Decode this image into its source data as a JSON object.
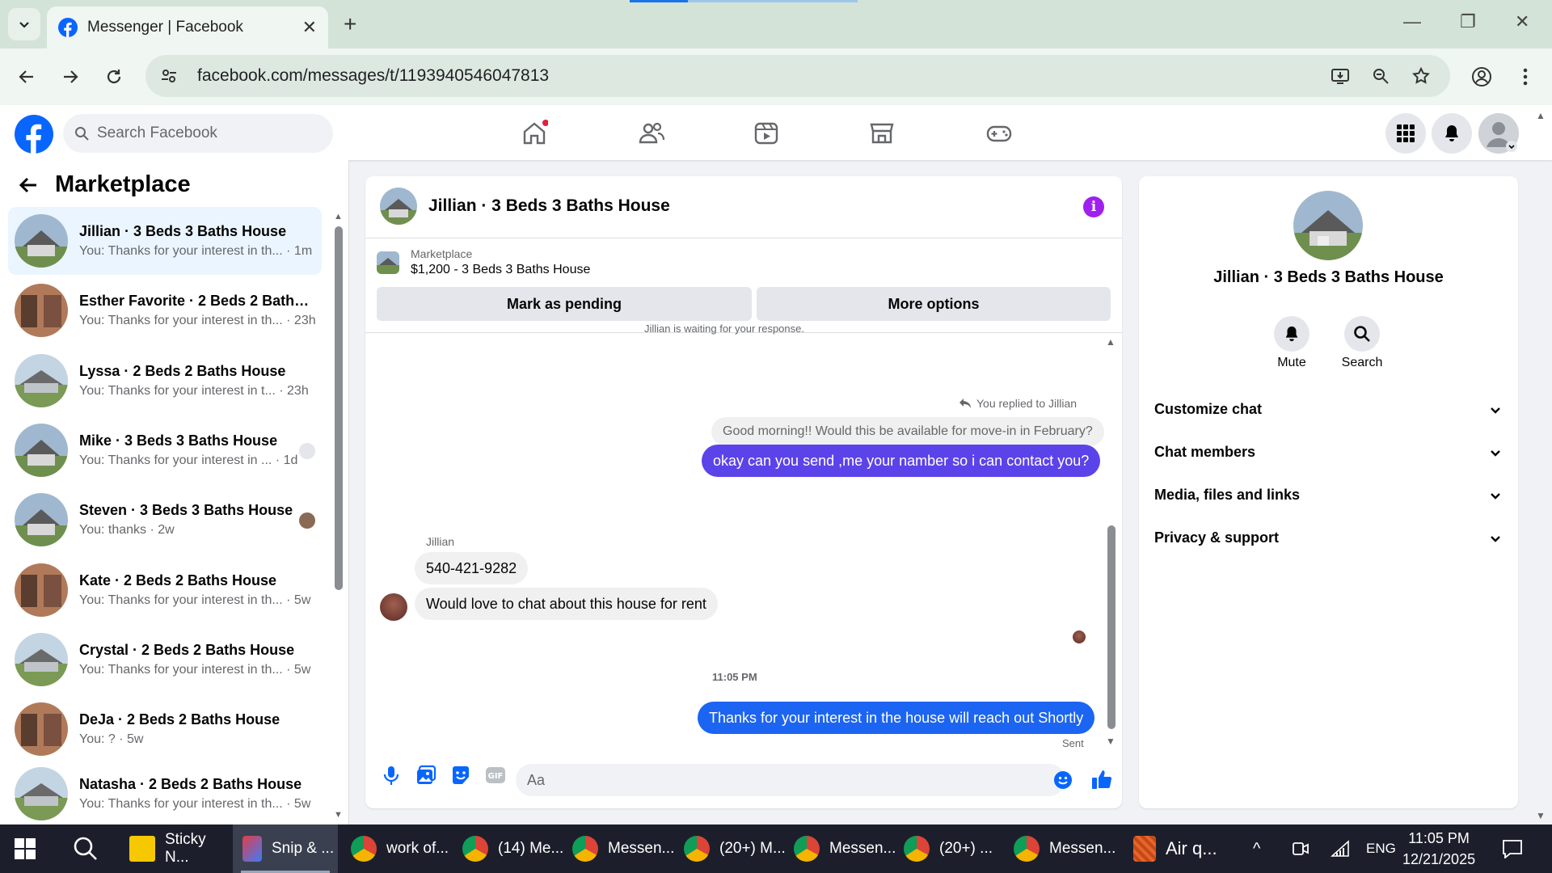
{
  "browser": {
    "tab_title": "Messenger | Facebook",
    "url": "facebook.com/messages/t/1193940546047813"
  },
  "fb": {
    "search_placeholder": "Search Facebook"
  },
  "sidebar": {
    "title": "Marketplace",
    "conversations": [
      {
        "name": "Jillian · 3 Beds 3 Baths House",
        "preview": "You: Thanks for your interest in th... · 1m"
      },
      {
        "name": "Esther Favorite · 2 Beds 2 Baths ...",
        "preview": "You: Thanks for your interest in th... · 23h"
      },
      {
        "name": "Lyssa · 2 Beds 2 Baths House",
        "preview": "You: Thanks for your interest in t... · 23h"
      },
      {
        "name": "Mike · 3 Beds 3 Baths House",
        "preview": "You: Thanks for your interest in ... · 1d"
      },
      {
        "name": "Steven · 3 Beds 3 Baths House",
        "preview": "You: thanks · 2w"
      },
      {
        "name": "Kate · 2 Beds 2 Baths House",
        "preview": "You: Thanks for your interest in th... · 5w"
      },
      {
        "name": "Crystal · 2 Beds 2 Baths House",
        "preview": "You: Thanks for your interest in th... · 5w"
      },
      {
        "name": "DeJa · 2 Beds 2 Baths House",
        "preview": "You: ? · 5w"
      },
      {
        "name": "Natasha · 2 Beds 2 Baths House",
        "preview": "You: Thanks for your interest in th... · 5w"
      }
    ]
  },
  "chat": {
    "title": "Jillian · 3 Beds 3 Baths House",
    "listing_label": "Marketplace",
    "listing_detail": "$1,200 - 3 Beds 3 Baths House",
    "mark_pending": "Mark as pending",
    "more_options": "More options",
    "waiting_note": "Jillian is waiting for your response.",
    "replied_note": "You replied to Jillian",
    "quoted": "Good morning!! Would this be available for move-in in February?",
    "msg_out1": "okay can you send ,me your namber so i can contact you?",
    "sender": "Jillian",
    "msg_in1": "540-421-9282",
    "msg_in2": "Would love to chat about this house for rent",
    "time": "11:05 PM",
    "msg_out2": "Thanks for your interest in the house will reach out Shortly",
    "status": "Sent",
    "composer_placeholder": "Aa"
  },
  "right": {
    "name": "Jillian · 3 Beds 3 Baths House",
    "mute": "Mute",
    "search": "Search",
    "sections": [
      "Customize chat",
      "Chat members",
      "Media, files and links",
      "Privacy & support"
    ]
  },
  "taskbar": {
    "items": [
      "Sticky N...",
      "Snip & ...",
      "work of...",
      "(14) Me...",
      "Messen...",
      "(20+) M...",
      "Messen...",
      "(20+) ...",
      "Messen...",
      "Air q..."
    ],
    "lang": "ENG",
    "time": "11:05 PM",
    "date": "12/21/2025"
  },
  "colors": {
    "fb_blue": "#0866ff",
    "outgoing_bubble": "#5b43ea",
    "outgoing_bubble_2": "#1c64f2",
    "info_purple": "#a020f0"
  }
}
